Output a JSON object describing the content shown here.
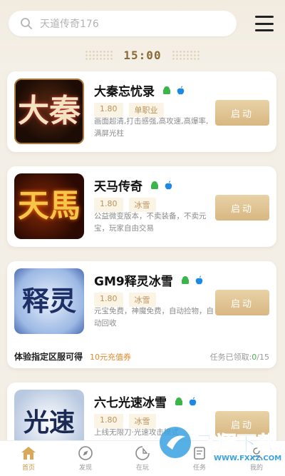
{
  "search": {
    "placeholder": "天道传奇176"
  },
  "time": "15:00",
  "start_label": "启动",
  "games": [
    {
      "name": "大秦忘忧录",
      "version": "1.80",
      "tag": "单职业",
      "desc": "画面超清,打击感强,高攻速,高爆率,满屏光柱",
      "cover_text": "大秦"
    },
    {
      "name": "天马传奇",
      "version": "1.80",
      "tag": "冰雪",
      "desc": "公益微变版本，不卖装备，不卖元宝，玩家自由交易",
      "cover_text": "天馬"
    },
    {
      "name": "GM9释灵冰雪",
      "version": "1.80",
      "tag": "冰雪",
      "desc": "元宝免费，神魔免费，自动捡物，自动回收",
      "cover_text": "释灵"
    },
    {
      "name": "六七光速冰雪",
      "version": "1.80",
      "tag": "冰雪",
      "desc": "上线无限刀·光速攻击模式",
      "cover_text": "光速"
    }
  ],
  "promo": {
    "title": "体验指定区服可得",
    "reward": "10元充值券",
    "status_prefix": "任务已领取:",
    "done": "0",
    "total": "/15"
  },
  "tabs": [
    {
      "label": "首页",
      "icon": "home-icon",
      "active": true
    },
    {
      "label": "发现",
      "icon": "compass-icon",
      "active": false
    },
    {
      "label": "在玩",
      "icon": "gamepad-icon",
      "active": false
    },
    {
      "label": "任务",
      "icon": "task-icon",
      "active": false
    },
    {
      "label": "我的",
      "icon": "profile-icon",
      "active": false
    }
  ],
  "watermark": {
    "text": "飞翔下载",
    "url": "WWW.FXXZ.COM"
  },
  "colors": {
    "accent": "#c8974a",
    "button": "#dcbc88",
    "tag_bg": "#fbf3e4",
    "android": "#3ab54a",
    "ios": "#1e88e5"
  }
}
